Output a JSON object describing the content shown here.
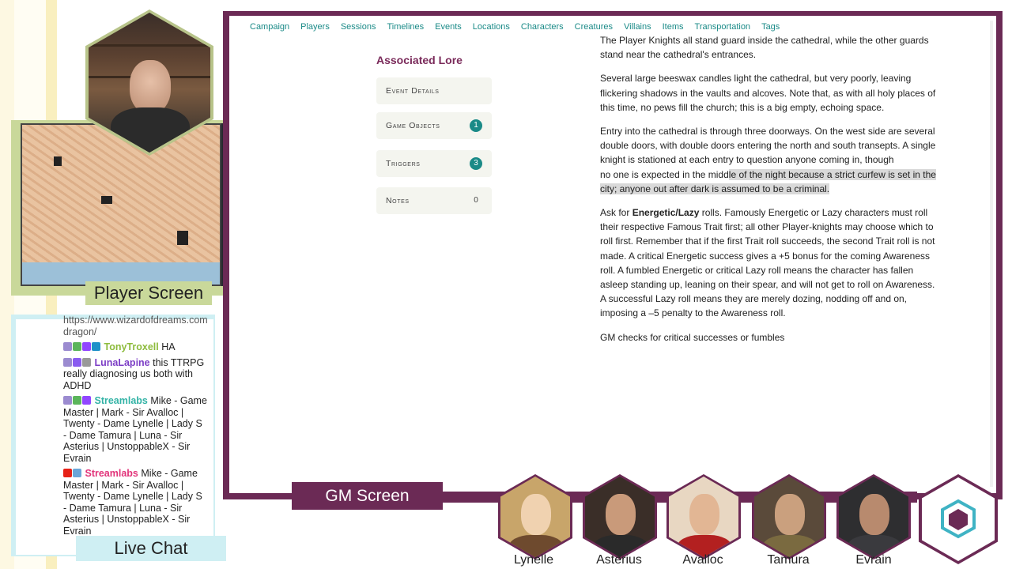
{
  "overlay": {
    "player_screen_label": "Player Screen",
    "live_chat_label": "Live Chat",
    "gm_screen_label": "GM Screen"
  },
  "nav": {
    "items": [
      "Campaign",
      "Players",
      "Sessions",
      "Timelines",
      "Events",
      "Locations",
      "Characters",
      "Creatures",
      "Villains",
      "Items",
      "Transportation",
      "Tags"
    ]
  },
  "lore": {
    "title": "Associated Lore",
    "items": [
      {
        "label": "Event Details",
        "count": ""
      },
      {
        "label": "Game Objects",
        "count": "1"
      },
      {
        "label": "Triggers",
        "count": "3"
      },
      {
        "label": "Notes",
        "count": "0"
      }
    ]
  },
  "doc": {
    "p1": "The Player Knights all stand guard inside the cathedral, while the other guards stand near the cathedral's entrances.",
    "p2": "Several large beeswax candles light the cathedral, but very poorly, leaving flickering shadows in the vaults and alcoves. Note that, as with all holy places of this time, no pews fill the church; this is a big empty, echoing space.",
    "p3a": "Entry into the cathedral is through three doorways. On the west side are several double doors, with double doors entering the north and south transepts. A single knight is stationed at each entry to question anyone coming in, though",
    "p3b_plain": "no one is expected in the midd",
    "p3b_hl": "le of the night because a strict curfew is set in the city; anyone out after dark is assumed to be a criminal.",
    "p4_pre": "Ask for ",
    "p4_bold": "Energetic/Lazy",
    "p4_post": " rolls. Famously Energetic or Lazy characters must roll their respective Famous Trait first; all other Player-knights may choose which to roll first. Remember that if the first Trait roll succeeds, the second Trait roll is not made. A critical Energetic success gives a +5 bonus for the coming Awareness roll. A fumbled Energetic or critical Lazy roll means the character has fallen asleep standing up, leaning on their spear, and will not get to roll on Awareness. A successful Lazy roll means they are merely dozing, nodding off and on, imposing a –5 penalty to the Awareness roll.",
    "p5": "GM checks for critical successes or fumbles"
  },
  "chat": {
    "url": "https://www.wizardofdreams.com/pen-dragon/",
    "messages": [
      {
        "user": "TonyTroxell",
        "text": "HA"
      },
      {
        "user": "LunaLapine",
        "text": "this TTRPG really diagnosing us both with ADHD"
      },
      {
        "user": "Streamlabs",
        "text": "Mike - Game Master | Mark - Sir Avalloc | Twenty - Dame Lynelle | Lady S - Dame Tamura | Luna - Sir Asterius | UnstoppableX - Sir Evrain"
      },
      {
        "user": "Streamlabs",
        "text": "Mike - Game Master | Mark - Sir Avalloc | Twenty - Dame Lynelle | Lady S - Dame Tamura | Luna - Sir Asterius | UnstoppableX - Sir Evrain"
      }
    ]
  },
  "players": [
    "Lynelle",
    "Asterius",
    "Avalloc",
    "Tamura",
    "Evrain"
  ],
  "colors": {
    "accent": "#6b2a55",
    "nav_link": "#1a8a87",
    "player_frame": "#c9d89a",
    "chat_frame": "#cfeff3"
  }
}
